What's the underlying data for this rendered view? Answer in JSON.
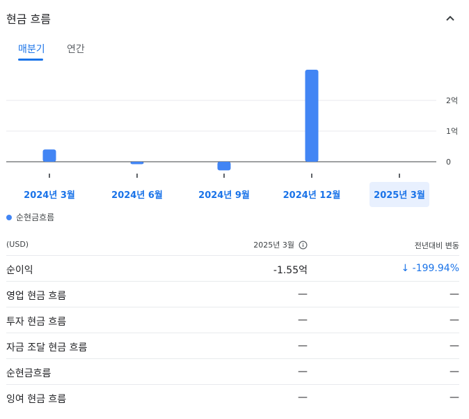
{
  "header": {
    "title": "현금 흐름"
  },
  "tabs": [
    {
      "label": "매분기",
      "active": true
    },
    {
      "label": "연간",
      "active": false
    }
  ],
  "chart_data": {
    "type": "bar",
    "categories": [
      "2024년 3월",
      "2024년 6월",
      "2024년 9월",
      "2024년 12월",
      "2025년 3월"
    ],
    "selected_category": "2025년 3월",
    "series": [
      {
        "name": "순현금흐름",
        "values": [
          0.4,
          -0.08,
          -0.28,
          3.0,
          0
        ]
      }
    ],
    "y_tick_labels": [
      "0",
      "1억",
      "2억"
    ],
    "y_ticks": [
      0,
      1,
      2
    ],
    "ylim": [
      -0.5,
      3.0
    ],
    "unit": "억",
    "grid": true,
    "legend": "bottom-left",
    "colors": {
      "bar": "#4285f4",
      "label": "#1a73e8",
      "selected_bg": "#e8f0fe"
    }
  },
  "table": {
    "header": {
      "currency": "(USD)",
      "period": "2025년 3월",
      "change": "전년대비 변동"
    },
    "rows": [
      {
        "label": "순이익",
        "value": "-1.55억",
        "change": "↓ -199.94%",
        "change_negative": true
      },
      {
        "label": "영업 현금 흐름",
        "value": "—",
        "change": "—"
      },
      {
        "label": "투자 현금 흐름",
        "value": "—",
        "change": "—"
      },
      {
        "label": "자금 조달 현금 흐름",
        "value": "—",
        "change": "—"
      },
      {
        "label": "순현금흐름",
        "value": "—",
        "change": "—"
      },
      {
        "label": "잉여 현금 흐름",
        "value": "—",
        "change": "—"
      }
    ]
  }
}
